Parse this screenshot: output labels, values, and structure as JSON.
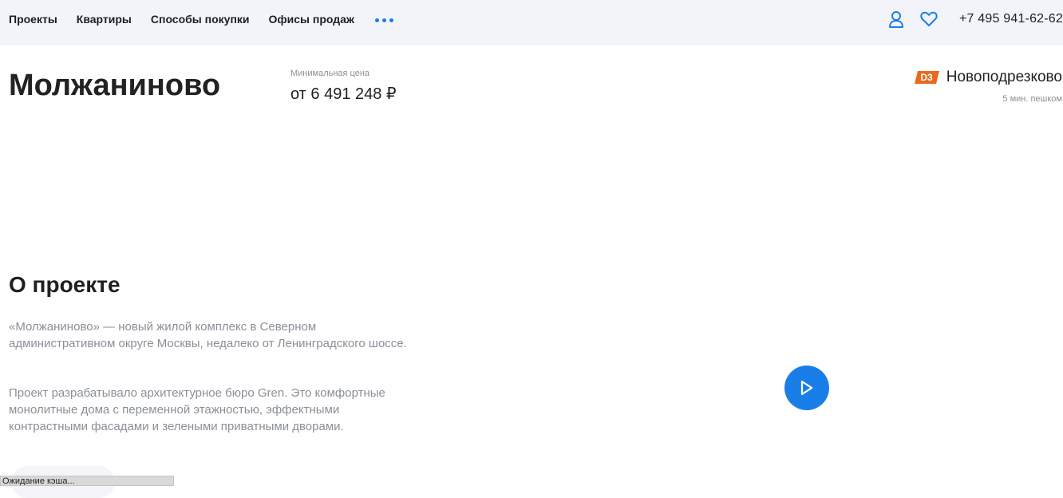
{
  "header": {
    "nav": [
      {
        "label": "Проекты"
      },
      {
        "label": "Квартиры"
      },
      {
        "label": "Способы покупки"
      },
      {
        "label": "Офисы продаж"
      }
    ],
    "more_icon": "more-dots-icon",
    "user_icon": "user-icon",
    "favorites_icon": "heart-icon",
    "phone": "+7 495 941-62-62"
  },
  "project": {
    "title": "Молжаниново",
    "price_label": "Минимальная цена",
    "price_value": "от 6 491 248 ₽",
    "metro": {
      "line": "D3",
      "line_color": "#e86a1c",
      "station": "Новоподрезково",
      "walk": "5 мин. пешком"
    }
  },
  "about": {
    "heading": "О проекте",
    "paragraphs": [
      "«Молжаниново» — новый жилой комплекс в Северном административном округе Москвы, недалеко от Ленинградского шоссе.",
      "Проект разрабатывало архитектурное бюро Gren. Это комфортные монолитные дома с переменной этажностью, эффектными контрастными фасадами и зелеными приватными дворами."
    ]
  },
  "video": {
    "play_icon": "play-icon",
    "accent": "#1a7ee8"
  },
  "status_bar": {
    "text": "Ожидание кэша..."
  }
}
